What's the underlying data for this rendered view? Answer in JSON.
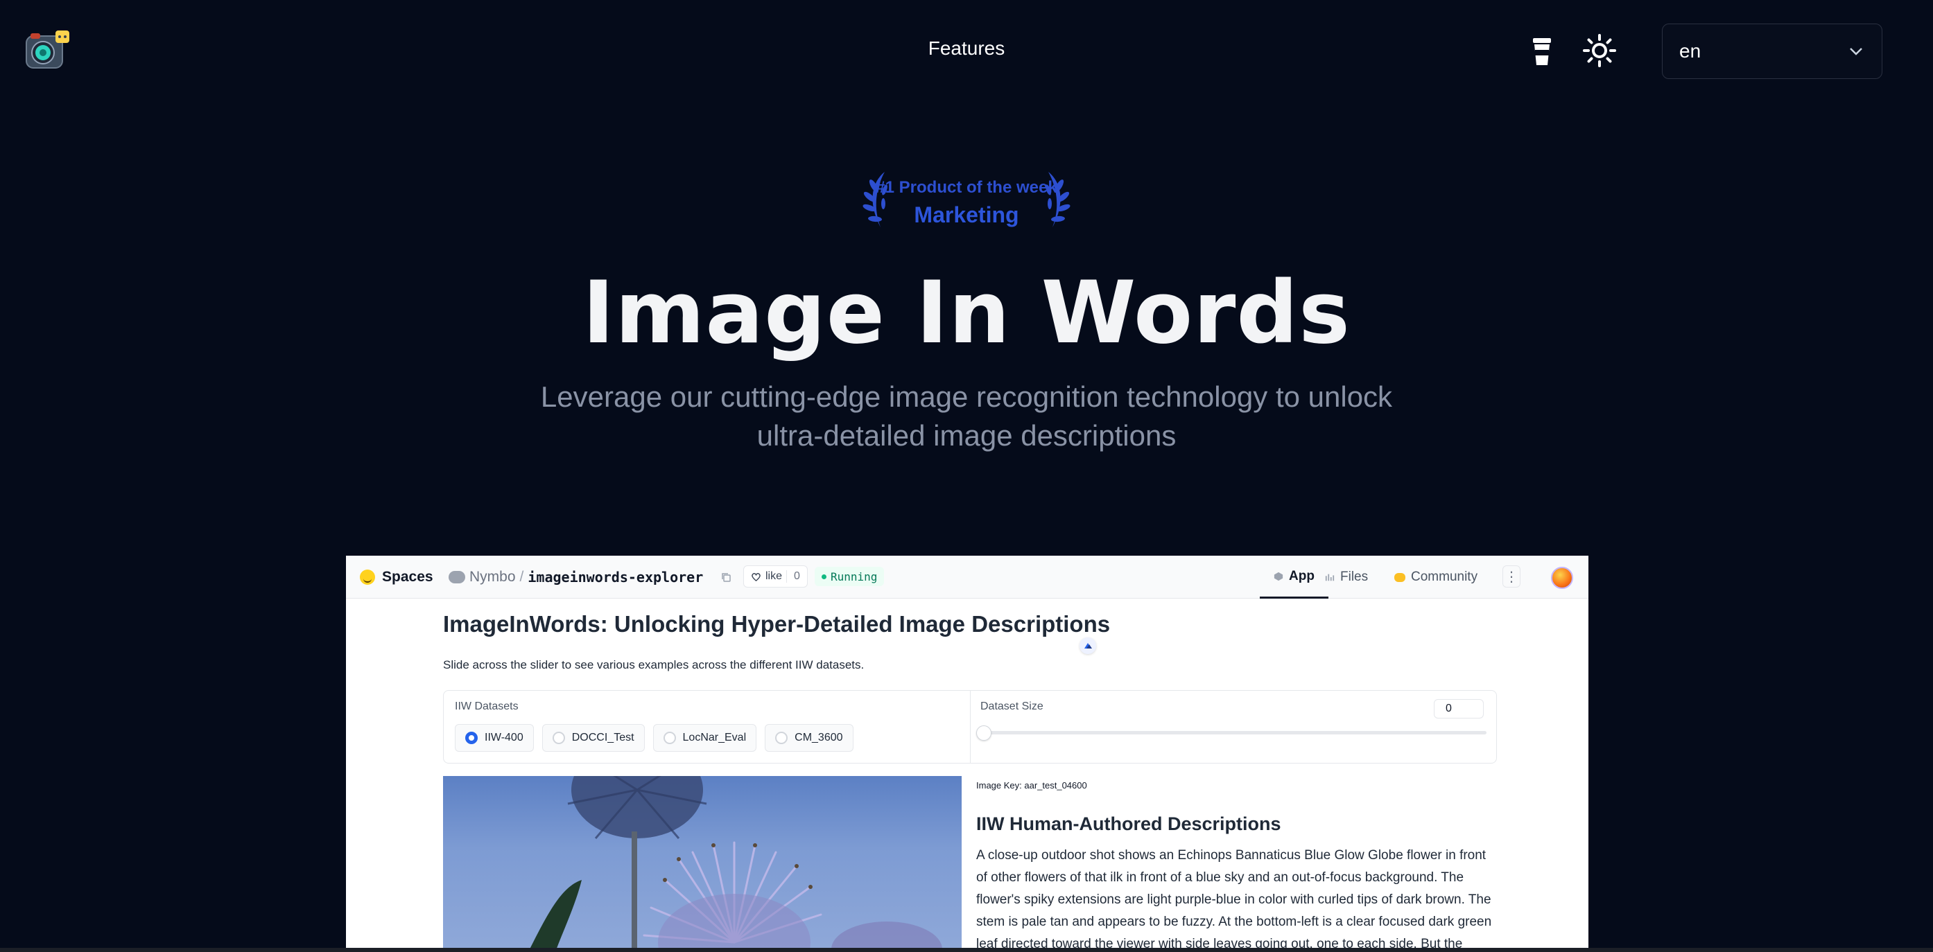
{
  "nav": {
    "features_label": "Features",
    "language": "en"
  },
  "badge": {
    "line1": "#1 Product of the week",
    "line2": "Marketing"
  },
  "hero": {
    "title": "Image In Words",
    "subtitle_line1": "Leverage our cutting-edge image recognition technology to unlock",
    "subtitle_line2": "ultra-detailed image descriptions"
  },
  "space": {
    "spaces_label": "Spaces",
    "owner": "Nymbo",
    "separator": "/",
    "repo": "imageinwords-explorer",
    "like_label": "like",
    "like_count": "0",
    "status": "Running",
    "tabs": {
      "app": "App",
      "files": "Files",
      "community": "Community"
    }
  },
  "app": {
    "title": "ImageInWords: Unlocking Hyper-Detailed Image Descriptions",
    "description": "Slide across the slider to see various examples across the different IIW datasets.",
    "datasets_label": "IIW Datasets",
    "datasets": [
      "IIW-400",
      "DOCCI_Test",
      "LocNar_Eval",
      "CM_3600"
    ],
    "selected_dataset": "IIW-400",
    "dataset_size_label": "Dataset Size",
    "dataset_size_value": "0",
    "slider_value": 0,
    "image_key": "Image Key: aar_test_04600",
    "desc_heading": "IIW Human-Authored Descriptions",
    "desc_text": "A close-up outdoor shot shows an Echinops Bannaticus Blue Glow Globe flower in front of other flowers of that ilk in front of a blue sky and an out-of-focus background. The flower's spiky extensions are light purple-blue in color with curled tips of dark brown. The stem is pale tan and appears to be fuzzy. At the bottom-left is a clear focused dark green leaf directed toward the viewer with side leaves going out, one to each side. But the bloom"
  },
  "colors": {
    "page_bg": "#050b1a",
    "badge_blue": "#2d55db",
    "subtitle_gray": "#8a93a6",
    "accent_radio": "#2563eb",
    "running_green": "#10b981"
  }
}
